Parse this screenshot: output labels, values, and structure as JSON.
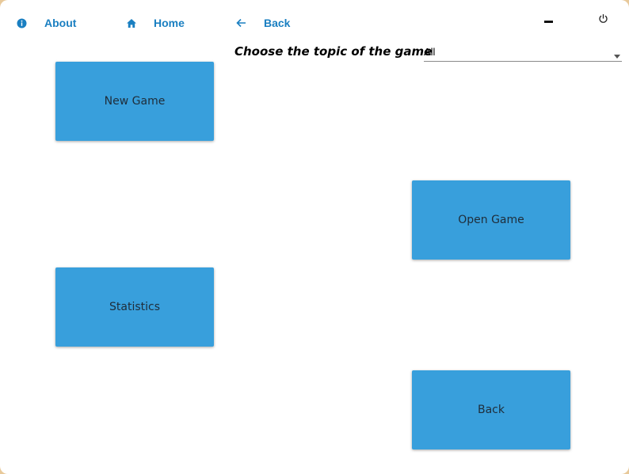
{
  "nav": {
    "about": {
      "label": "About",
      "icon": "info-icon"
    },
    "home": {
      "label": "Home",
      "icon": "home-icon"
    },
    "back": {
      "label": "Back",
      "icon": "arrow-left-icon"
    }
  },
  "window_controls": {
    "minimize_icon": "minimize-icon",
    "power_icon": "power-icon"
  },
  "topic": {
    "label": "Choose the topic of the game",
    "selected": "All"
  },
  "tiles": {
    "new_game": "New Game",
    "open_game": "Open Game",
    "statistics": "Statistics",
    "back": "Back"
  },
  "colors": {
    "accent": "#1a7fc1",
    "tile": "#389fdc",
    "tile_text": "#1f2d3a"
  }
}
